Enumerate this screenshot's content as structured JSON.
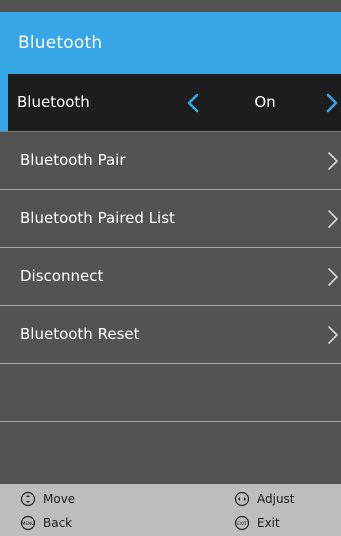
{
  "header": {
    "title": "Bluetooth"
  },
  "menu": {
    "items": [
      {
        "label": "Bluetooth",
        "value": "On"
      },
      {
        "label": "Bluetooth Pair"
      },
      {
        "label": "Bluetooth Paired List"
      },
      {
        "label": "Disconnect"
      },
      {
        "label": "Bluetooth Reset"
      }
    ]
  },
  "footer": {
    "move_label": "Move",
    "adjust_label": "Adjust",
    "back_label": "Back",
    "exit_label": "Exit",
    "menu_icon_text": "MENU",
    "exit_icon_text": "EXIT"
  },
  "icons": {
    "left_arrow": "chevron-left-icon",
    "right_arrow": "chevron-right-icon",
    "move": "move-icon",
    "adjust": "adjust-icon",
    "menu": "menu-button-icon",
    "exit": "exit-button-icon"
  },
  "colors": {
    "accent": "#36a6e6",
    "panel_bg": "#535353",
    "selected_bg": "#1d1d1d",
    "footer_bg": "#bdbdbd",
    "text": "#ffffff"
  }
}
